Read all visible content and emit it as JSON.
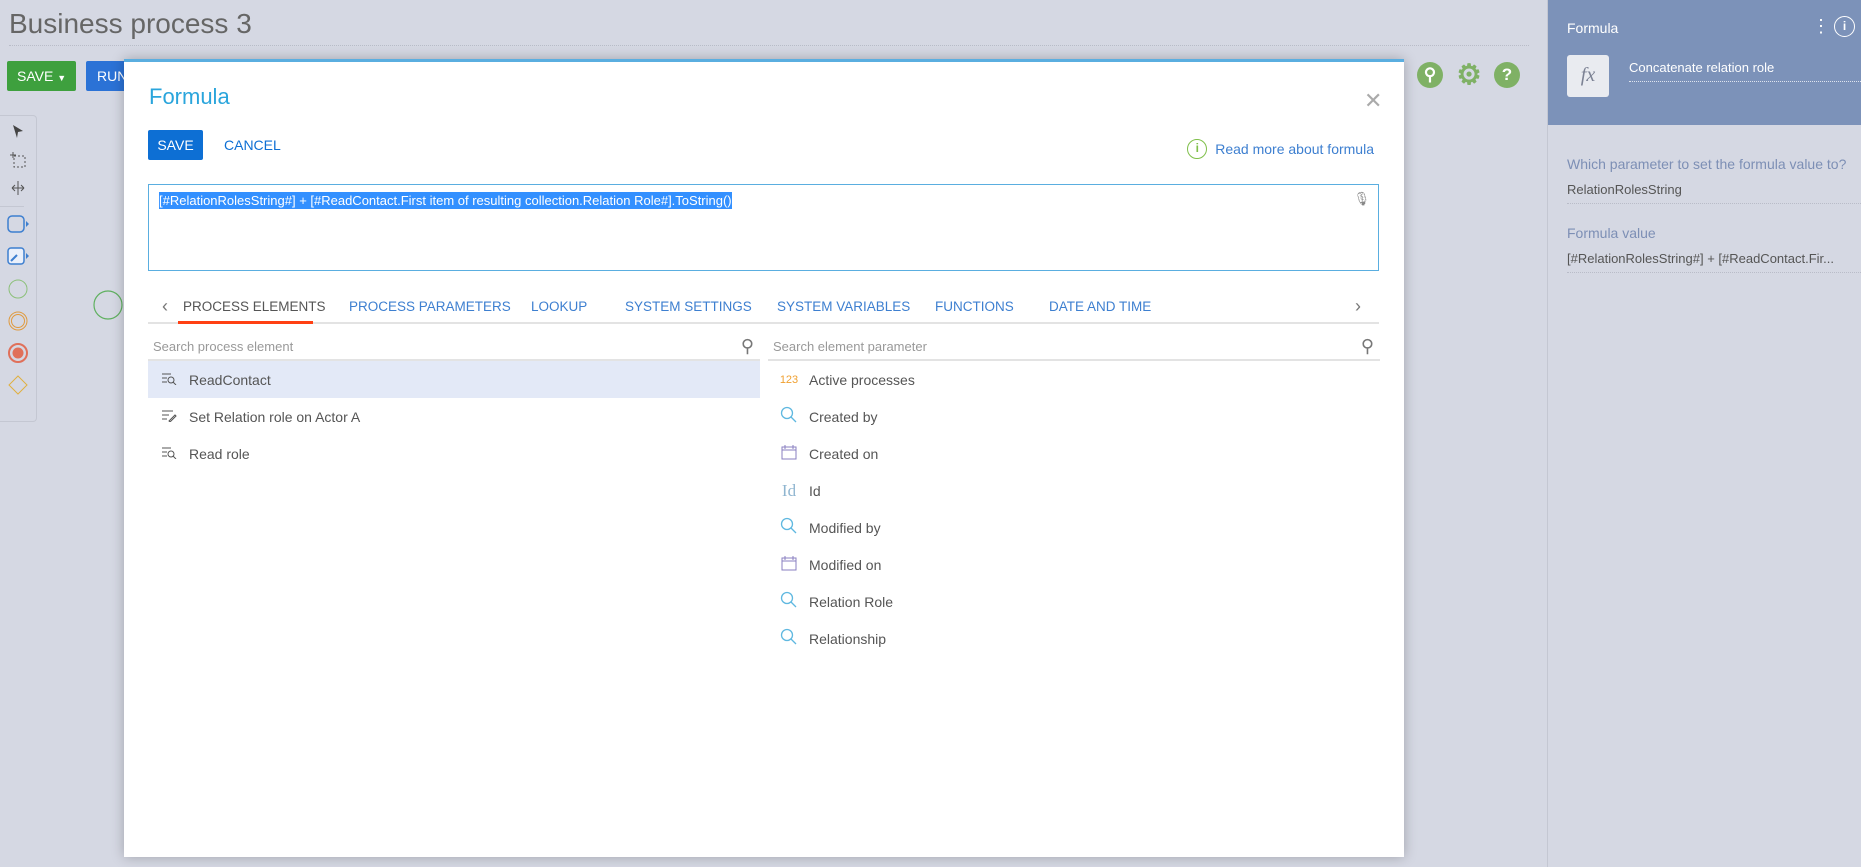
{
  "page": {
    "title": "Business process 3",
    "save_label": "SAVE",
    "run_label": "RUN"
  },
  "header_icons": [
    "search-icon",
    "gear-icon",
    "help-icon"
  ],
  "dialog": {
    "title": "Formula",
    "save_label": "SAVE",
    "cancel_label": "CANCEL",
    "read_more_label": "Read more about formula",
    "formula": "[#RelationRolesString#] + [#ReadContact.First item of resulting collection.Relation Role#].ToString()",
    "tabs": [
      "PROCESS ELEMENTS",
      "PROCESS PARAMETERS",
      "LOOKUP",
      "SYSTEM SETTINGS",
      "SYSTEM VARIABLES",
      "FUNCTIONS",
      "DATE AND TIME"
    ],
    "active_tab": "PROCESS ELEMENTS",
    "left_search_placeholder": "Search process element",
    "right_search_placeholder": "Search element parameter",
    "process_elements": [
      {
        "label": "ReadContact",
        "icon": "read-data-icon",
        "selected": true
      },
      {
        "label": "Set Relation role on Actor A",
        "icon": "modify-data-icon"
      },
      {
        "label": "Read role",
        "icon": "read-data-icon"
      }
    ],
    "parameters": [
      {
        "label": "Active processes",
        "icon": "number-icon",
        "glyph": "123"
      },
      {
        "label": "Created by",
        "icon": "lookup-icon"
      },
      {
        "label": "Created on",
        "icon": "calendar-icon"
      },
      {
        "label": "Id",
        "icon": "id-icon",
        "glyph": "Id"
      },
      {
        "label": "Modified by",
        "icon": "lookup-icon"
      },
      {
        "label": "Modified on",
        "icon": "calendar-icon"
      },
      {
        "label": "Relation Role",
        "icon": "lookup-icon"
      },
      {
        "label": "Relationship",
        "icon": "lookup-icon"
      }
    ]
  },
  "right_panel": {
    "title": "Formula",
    "element_name": "Concatenate relation role",
    "fx": "fx",
    "param_label": "Which parameter to set the formula value to?",
    "param_value": "RelationRolesString",
    "formula_label": "Formula value",
    "formula_value": "[#RelationRolesString#] + [#ReadContact.Fir..."
  },
  "colors": {
    "accent": "#0d6fd4",
    "save_green": "#3ea03e",
    "tab_underline": "#ff4013",
    "panel_header": "#7c92b9"
  }
}
